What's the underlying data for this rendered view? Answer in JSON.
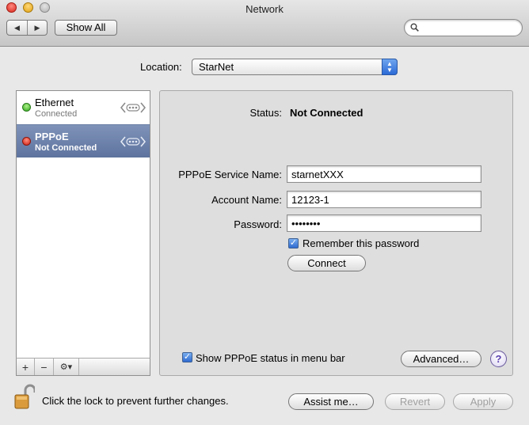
{
  "window": {
    "title": "Network"
  },
  "toolbar": {
    "show_all_label": "Show All",
    "search_value": ""
  },
  "location": {
    "label": "Location:",
    "value": "StarNet"
  },
  "services": [
    {
      "name": "Ethernet",
      "status": "Connected",
      "status_color": "#2ea81a"
    },
    {
      "name": "PPPoE",
      "status": "Not Connected",
      "status_color": "#cc1d10"
    }
  ],
  "sidebar_buttons": {
    "add": "+",
    "remove": "−",
    "gear": "⚙▾"
  },
  "detail": {
    "status_label": "Status:",
    "status_value": "Not Connected",
    "service_name_label": "PPPoE Service Name:",
    "service_name_value": "starnetXXX",
    "account_name_label": "Account Name:",
    "account_name_value": "12123-1",
    "password_label": "Password:",
    "password_value": "••••••••",
    "remember_label": "Remember this password",
    "remember_checked": true,
    "connect_label": "Connect",
    "show_status_label": "Show PPPoE status in menu bar",
    "show_status_checked": true,
    "advanced_label": "Advanced…",
    "help_label": "?"
  },
  "footer": {
    "lock_text": "Click the lock to prevent further changes.",
    "assist_label": "Assist me…",
    "revert_label": "Revert",
    "apply_label": "Apply"
  },
  "colors": {
    "selection": "#6b7fa6",
    "accent": "#2f6bd0"
  }
}
